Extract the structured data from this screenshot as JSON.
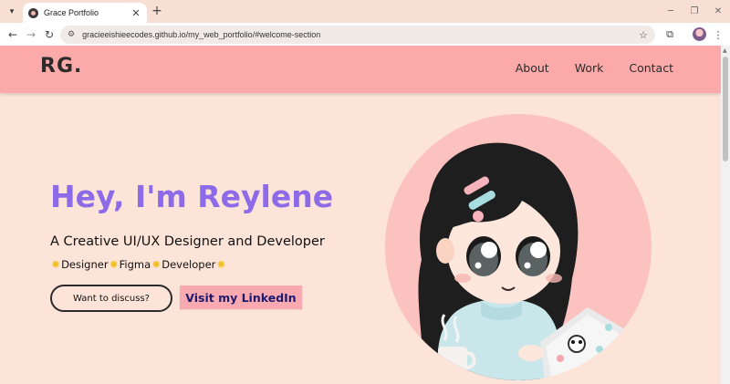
{
  "browser": {
    "tab_title": "Grace Portfolio",
    "url": "gracieeishieecodes.github.io/my_web_portfolio/#welcome-section",
    "icons": {
      "tab_menu": "chevron-down-icon",
      "close": "close-icon",
      "new_tab": "plus-icon",
      "back": "back-arrow-icon",
      "forward": "forward-arrow-icon",
      "reload": "reload-icon",
      "site_info": "tune-icon",
      "bookmark": "star-icon",
      "extensions": "puzzle-icon",
      "menu": "kebab-menu-icon"
    }
  },
  "site": {
    "logo": "RG.",
    "nav": [
      "About",
      "Work",
      "Contact"
    ]
  },
  "hero": {
    "title": "Hey, I'm Reylene",
    "subtitle": "A Creative UI/UX Designer and Developer",
    "skills": [
      "Designer",
      "Figma",
      "Developer"
    ],
    "discuss_button": "Want to discuss?",
    "linkedin_button": "Visit my LinkedIn"
  },
  "colors": {
    "page_background": "#fde4d9",
    "header_background": "#fcaaa9",
    "title_purple": "#8d6be8",
    "linkedin_button_bg": "#f8aab0",
    "avatar_circle": "#fcc2c0"
  }
}
